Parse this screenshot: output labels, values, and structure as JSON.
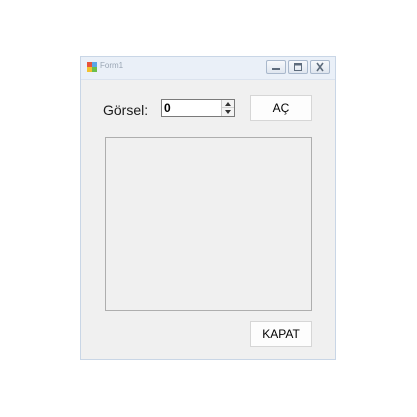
{
  "window": {
    "title": "Form1",
    "controls": {
      "minimize_icon": "minimize-icon",
      "maximize_icon": "maximize-icon",
      "close_icon": "close-icon"
    }
  },
  "form": {
    "gorsel_label": "Görsel:",
    "gorsel_value": "0",
    "open_button": "AÇ",
    "close_button": "KAPAT"
  },
  "colors": {
    "window_bg": "#f0f0f0",
    "titlebar_bg": "#eaf0f8",
    "border": "#c9d6e6"
  }
}
